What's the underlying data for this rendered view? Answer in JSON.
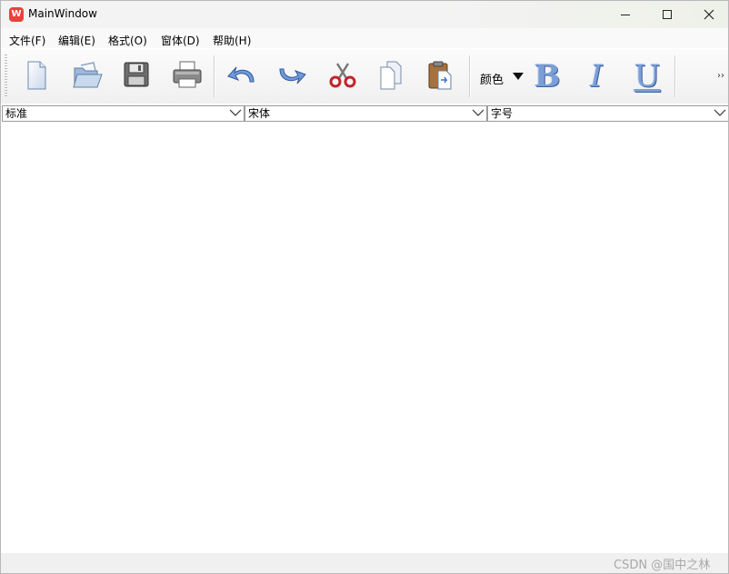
{
  "window": {
    "title": "MainWindow",
    "app_icon_glyph": "W"
  },
  "menu": {
    "items": [
      {
        "label": "文件(F)"
      },
      {
        "label": "编辑(E)"
      },
      {
        "label": "格式(O)"
      },
      {
        "label": "窗体(D)"
      },
      {
        "label": "帮助(H)"
      }
    ]
  },
  "toolbar": {
    "icons": [
      "new-file-icon",
      "open-folder-icon",
      "save-disk-icon",
      "print-icon",
      "undo-icon",
      "redo-icon",
      "cut-icon",
      "copy-icon",
      "paste-icon"
    ],
    "color_label": "颜色",
    "bold_glyph": "B",
    "italic_glyph": "I",
    "underline_glyph": "U",
    "more_glyph": "››"
  },
  "combos": {
    "style": "标准",
    "font": "宋体",
    "size": "字号"
  },
  "watermark": "CSDN @国中之林"
}
